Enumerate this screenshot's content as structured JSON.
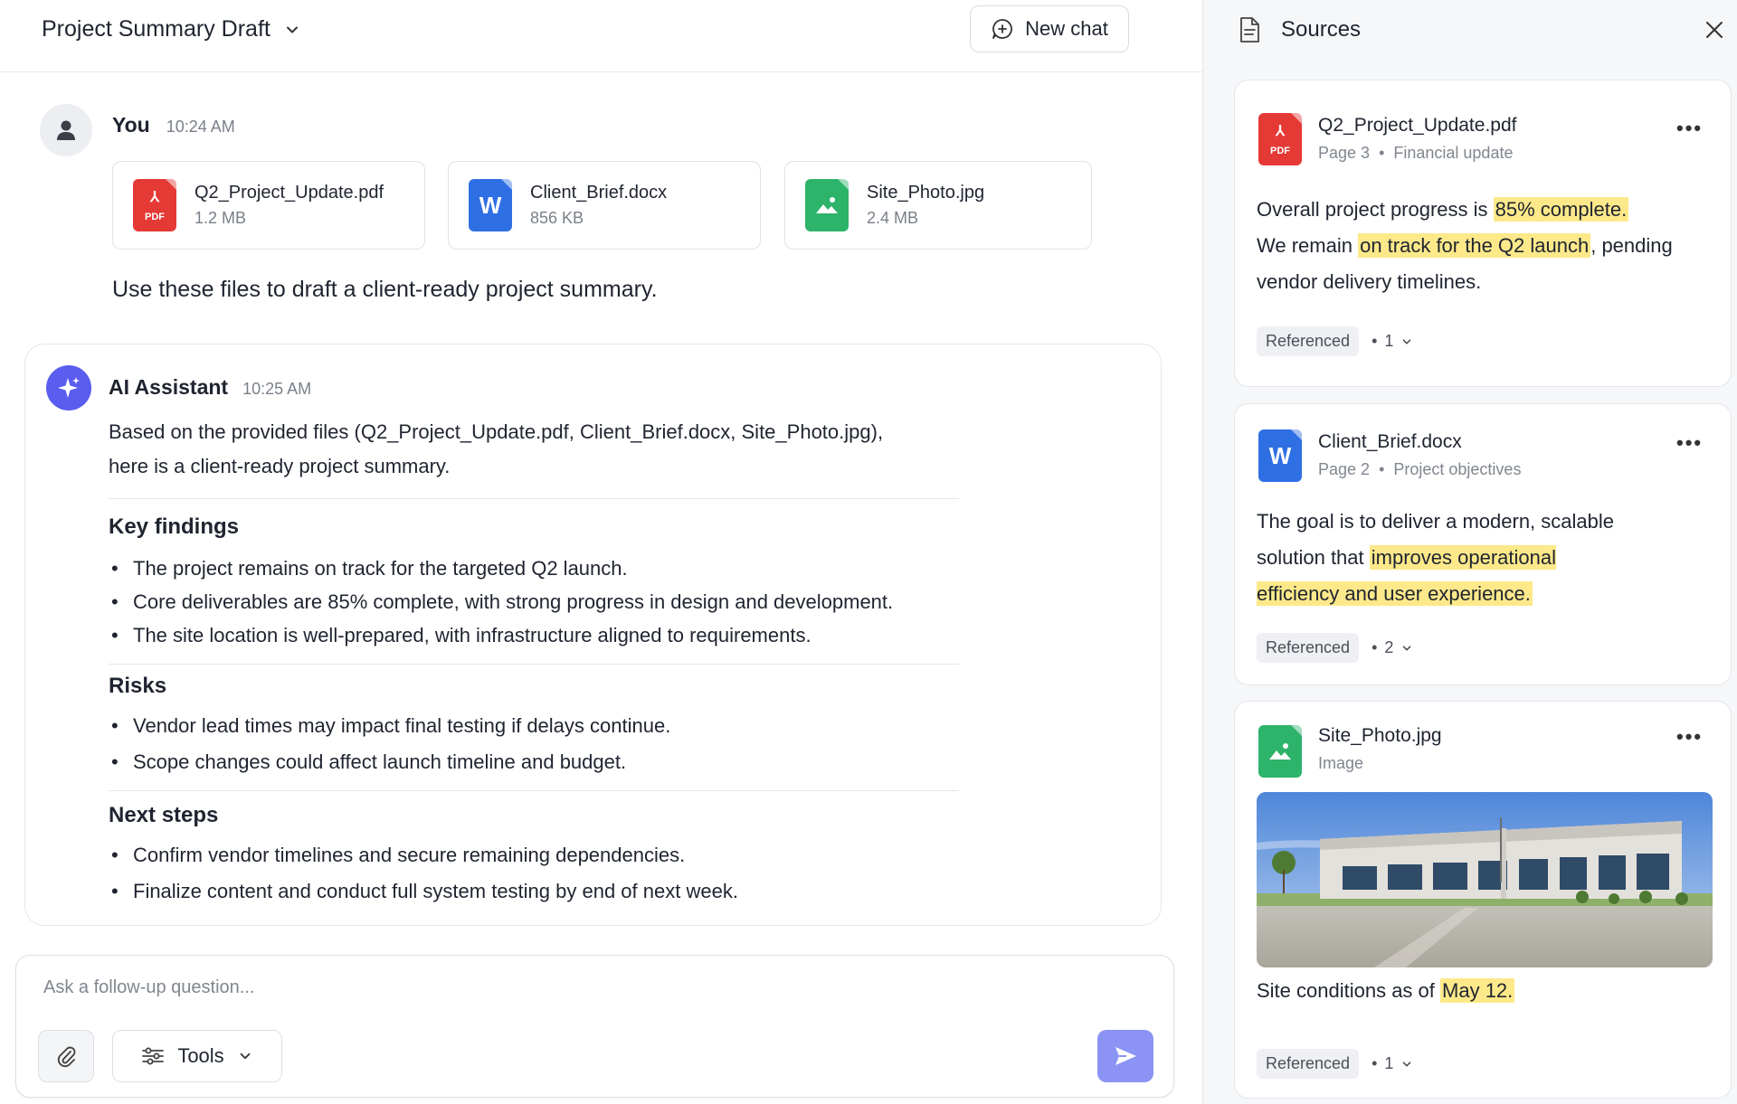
{
  "header": {
    "title": "Project Summary Draft",
    "new_chat_label": "New chat"
  },
  "user_message": {
    "author": "You",
    "time": "10:24 AM",
    "attachments": [
      {
        "name": "Q2_Project_Update.pdf",
        "size": "1.2 MB",
        "icon": "pdf-file-icon"
      },
      {
        "name": "Client_Brief.docx",
        "size": "856 KB",
        "icon": "word-file-icon"
      },
      {
        "name": "Site_Photo.jpg",
        "size": "2.4 MB",
        "icon": "image-file-icon"
      }
    ],
    "text": "Use these files to draft a client-ready project summary."
  },
  "ai_message": {
    "author": "AI Assistant",
    "time": "10:25 AM",
    "intro_line1": "Based on the provided files (Q2_Project_Update.pdf, Client_Brief.docx, Site_Photo.jpg),",
    "intro_line2": "here is a client-ready project summary.",
    "sections": [
      {
        "heading": "Key findings",
        "bullets": [
          "The project remains on track for the targeted Q2 launch.",
          "Core deliverables are 85% complete, with strong progress in design and development.",
          "The site location is well-prepared, with infrastructure aligned to requirements."
        ]
      },
      {
        "heading": "Risks",
        "bullets": [
          "Vendor lead times may impact final testing if delays continue.",
          "Scope changes could affect launch timeline and budget."
        ]
      },
      {
        "heading": "Next steps",
        "bullets": [
          "Confirm vendor timelines and secure remaining dependencies.",
          "Finalize content and conduct full system testing by end of next week."
        ]
      }
    ]
  },
  "composer": {
    "placeholder": "Ask a follow-up question...",
    "tools_label": "Tools"
  },
  "sources": {
    "title": "Sources",
    "items": [
      {
        "name": "Q2_Project_Update.pdf",
        "page": "Page 3",
        "section": "Financial update",
        "text_parts": [
          {
            "t": "Overall project progress is ",
            "hl": false
          },
          {
            "t": "85% complete.",
            "hl": true
          },
          {
            "t": " We remain ",
            "hl": false
          },
          {
            "t": "on track for the Q2 launch",
            "hl": true
          },
          {
            "t": ", pending vendor delivery timelines.",
            "hl": false
          }
        ],
        "badge": "Referenced",
        "count": "1"
      },
      {
        "name": "Client_Brief.docx",
        "page": "Page 2",
        "section": "Project objectives",
        "text_parts": [
          {
            "t": "The goal is to deliver a modern, scalable solution that ",
            "hl": false
          },
          {
            "t": "improves operational efficiency and user experience.",
            "hl": true
          }
        ],
        "badge": "Referenced",
        "count": "2"
      },
      {
        "name": "Site_Photo.jpg",
        "type": "Image",
        "text_parts": [
          {
            "t": "Site conditions as of ",
            "hl": false
          },
          {
            "t": "May 12.",
            "hl": true
          }
        ],
        "badge": "Referenced",
        "count": "1"
      }
    ]
  },
  "colors": {
    "accent": "#5b5cf0",
    "send_button": "#8b93f5",
    "highlight": "#fde98a",
    "pdf": "#e53935",
    "word": "#2f6fe4",
    "image": "#2db36a"
  }
}
